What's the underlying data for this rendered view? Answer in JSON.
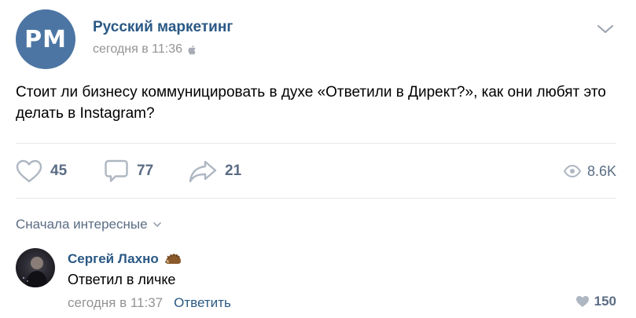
{
  "post": {
    "author": "Русский маркетинг",
    "avatar_text": "РМ",
    "time": "сегодня в 11:36",
    "text": "Стоит ли бизнесу коммуницировать в духе «Ответили в Директ?», как они любят это делать в Instagram?"
  },
  "actions": {
    "likes": "45",
    "comments": "77",
    "shares": "21",
    "views": "8.6K"
  },
  "comments_section": {
    "sort_label": "Сначала интересные"
  },
  "comment": {
    "author": "Сергей Лахно",
    "text": "Ответил в личке",
    "time": "сегодня в 11:37",
    "reply_label": "Ответить",
    "likes": "150"
  },
  "colors": {
    "link": "#2a5885",
    "muted": "#939393",
    "icon": "#aeb7c2",
    "avatar_bg": "#4c75a3"
  }
}
